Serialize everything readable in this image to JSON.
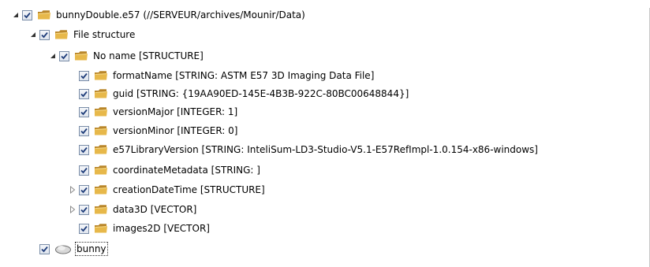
{
  "tree": {
    "rows": [
      {
        "label": "bunnyDouble.e57 (//SERVEUR/archives/Mounir/Data)",
        "expander": "expanded",
        "icon": "folder-icon",
        "checked": true,
        "depth": 0
      },
      {
        "label": "File structure",
        "expander": "expanded",
        "icon": "folder-icon",
        "checked": true,
        "depth": 1
      },
      {
        "label": "No name [STRUCTURE]",
        "expander": "expanded",
        "icon": "folder-icon",
        "checked": true,
        "depth": 2
      },
      {
        "label": "formatName [STRING: ASTM E57 3D Imaging Data File]",
        "expander": "none",
        "icon": "folder-icon",
        "checked": true,
        "depth": 3
      },
      {
        "label": "guid [STRING: {19AA90ED-145E-4B3B-922C-80BC00648844}]",
        "expander": "none",
        "icon": "folder-icon",
        "checked": true,
        "depth": 3
      },
      {
        "label": "versionMajor [INTEGER: 1]",
        "expander": "none",
        "icon": "folder-icon",
        "checked": true,
        "depth": 3
      },
      {
        "label": "versionMinor [INTEGER: 0]",
        "expander": "none",
        "icon": "folder-icon",
        "checked": true,
        "depth": 3
      },
      {
        "label": "e57LibraryVersion [STRING: InteliSum-LD3-Studio-V5.1-E57RefImpl-1.0.154-x86-windows]",
        "expander": "none",
        "icon": "folder-icon",
        "checked": true,
        "depth": 3
      },
      {
        "label": "coordinateMetadata [STRING: ]",
        "expander": "none",
        "icon": "folder-icon",
        "checked": true,
        "depth": 3
      },
      {
        "label": "creationDateTime [STRUCTURE]",
        "expander": "collapsed",
        "icon": "folder-icon",
        "checked": true,
        "depth": 3
      },
      {
        "label": "data3D [VECTOR]",
        "expander": "collapsed",
        "icon": "folder-icon",
        "checked": true,
        "depth": 3
      },
      {
        "label": "images2D [VECTOR]",
        "expander": "none",
        "icon": "folder-icon",
        "checked": true,
        "depth": 3
      },
      {
        "label": "bunny",
        "expander": "none",
        "icon": "cloud-icon",
        "checked": true,
        "depth": 1,
        "focused": true
      }
    ]
  },
  "colors": {
    "folder_body": "#e7b84a",
    "folder_dark": "#b9862a",
    "check_mark": "#1f3d7a",
    "arrow_fill": "#333333",
    "arrow_outline": "#8a8a8a"
  }
}
